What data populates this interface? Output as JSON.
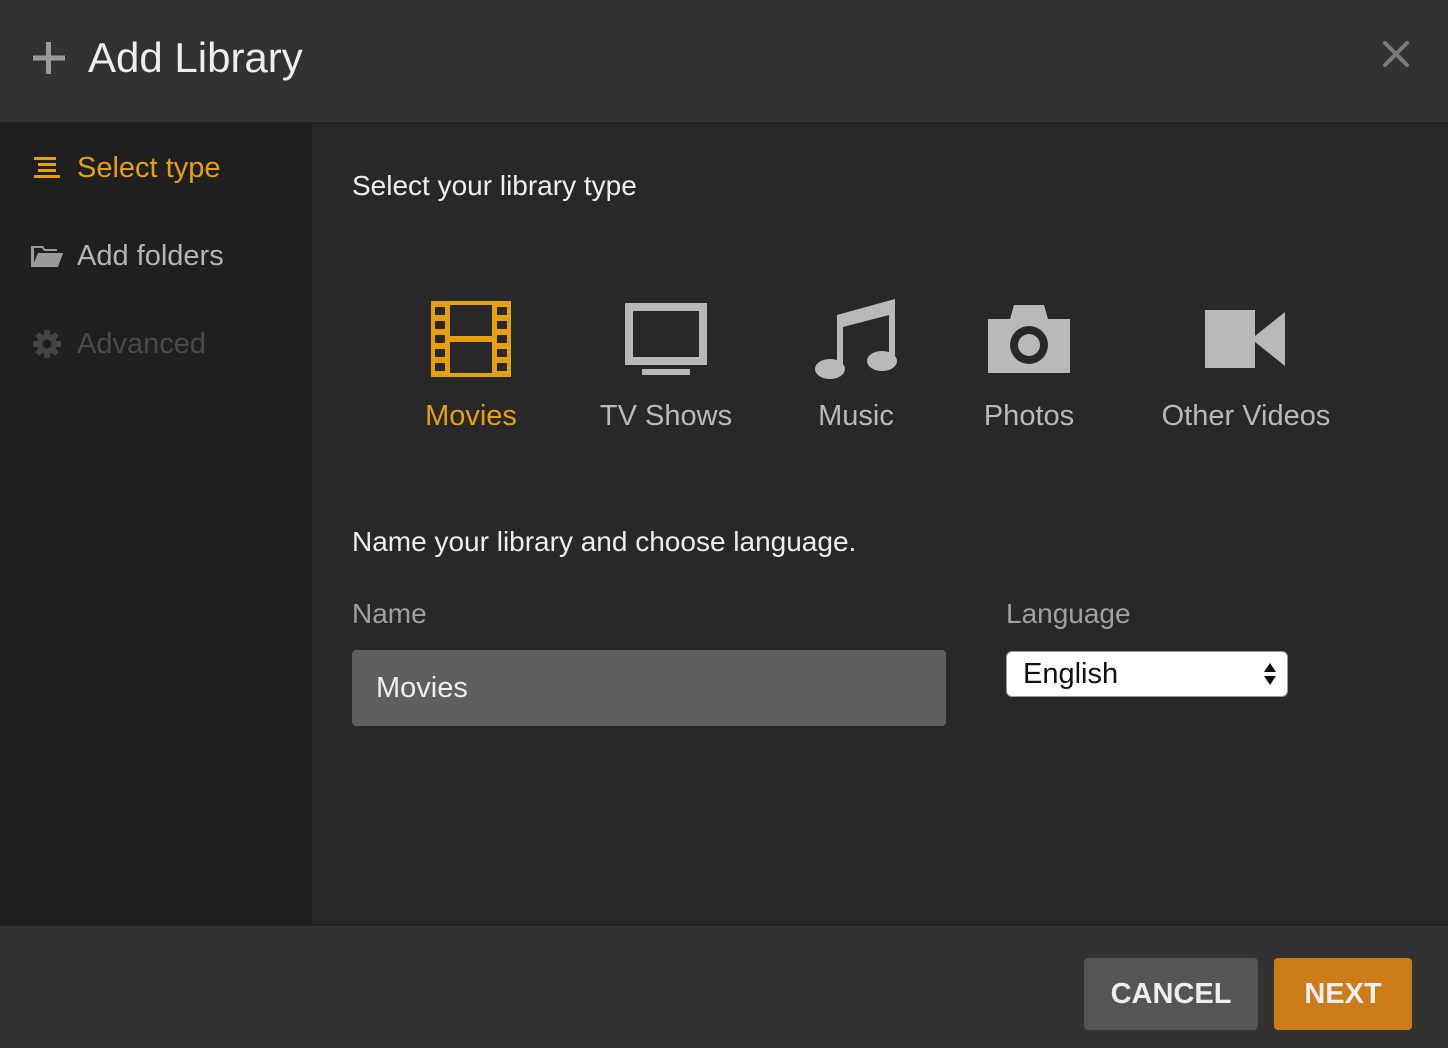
{
  "dialog": {
    "title": "Add Library"
  },
  "sidebar": {
    "items": [
      {
        "label": "Select type",
        "icon": "list-icon",
        "state": "active"
      },
      {
        "label": "Add folders",
        "icon": "folder-icon",
        "state": "normal"
      },
      {
        "label": "Advanced",
        "icon": "gear-icon",
        "state": "disabled"
      }
    ]
  },
  "main": {
    "type_heading": "Select your library type",
    "types": [
      {
        "label": "Movies",
        "icon": "film-icon",
        "selected": true
      },
      {
        "label": "TV Shows",
        "icon": "tv-icon",
        "selected": false
      },
      {
        "label": "Music",
        "icon": "music-note-icon",
        "selected": false
      },
      {
        "label": "Photos",
        "icon": "camera-icon",
        "selected": false
      },
      {
        "label": "Other Videos",
        "icon": "video-camera-icon",
        "selected": false
      }
    ],
    "name_heading": "Name your library and choose language.",
    "name_label": "Name",
    "name_value": "Movies",
    "language_label": "Language",
    "language_value": "English"
  },
  "footer": {
    "cancel_label": "CANCEL",
    "next_label": "NEXT"
  },
  "colors": {
    "accent": "#e5a00d",
    "next_button": "#cc7b19",
    "cancel_button": "#555555"
  }
}
